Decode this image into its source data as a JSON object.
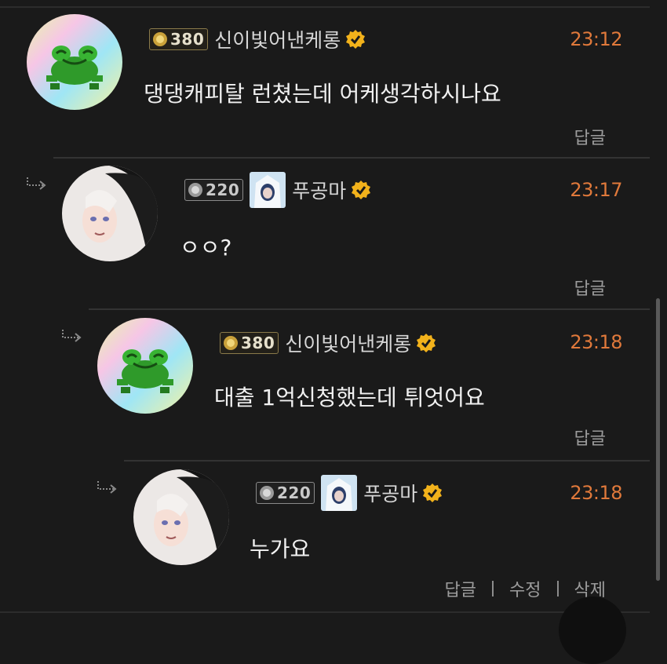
{
  "comments": [
    {
      "level": "380",
      "username": "신이빛어낸케롱",
      "time": "23:12",
      "text": "댕댕캐피탈 런쳤는데 어케생각하시나요",
      "reply_label": "답글"
    },
    {
      "level": "220",
      "username": "푸공마",
      "time": "23:17",
      "text": "ㅇㅇ?",
      "reply_label": "답글"
    },
    {
      "level": "380",
      "username": "신이빛어낸케롱",
      "time": "23:18",
      "text": "대출 1억신청했는데 튀엇어요",
      "reply_label": "답글"
    },
    {
      "level": "220",
      "username": "푸공마",
      "time": "23:18",
      "text": "누가요",
      "reply_label": "답글",
      "edit_label": "수정",
      "delete_label": "삭제"
    }
  ],
  "colors": {
    "background": "#1a1a1a",
    "time": "#e0793b",
    "verified": "#f2b21b",
    "muted": "#9c9c9c"
  },
  "icons": {
    "reply_indent": "reply-arrow-icon",
    "verified": "verified-check-icon",
    "level_gold": "gold-level-icon",
    "level_silver": "silver-level-icon"
  }
}
